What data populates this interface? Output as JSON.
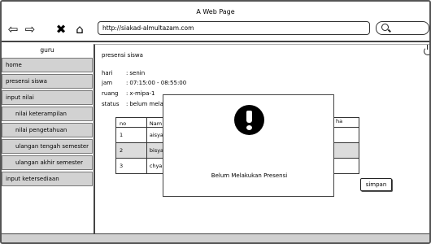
{
  "window": {
    "title": "A Web Page"
  },
  "browser": {
    "url": "http://siakad-almultazam.com",
    "back_icon": "arrow-left-icon",
    "forward_icon": "arrow-right-icon",
    "close_icon": "x-icon",
    "home_icon": "home-icon",
    "search_icon": "search-icon"
  },
  "sidebar": {
    "title": "guru",
    "items": [
      {
        "label": "home"
      },
      {
        "label": "presensi siswa"
      },
      {
        "label": "input nilai"
      },
      {
        "label": "nilai keterampilan"
      },
      {
        "label": "nilai pengetahuan"
      },
      {
        "label": "ulangan tengah semester"
      },
      {
        "label": "ulangan akhir semester"
      },
      {
        "label": "input ketersediaan"
      }
    ]
  },
  "main": {
    "section_title": "presensi siswa",
    "info": [
      {
        "label": "hari",
        "value": "senin"
      },
      {
        "label": "jam",
        "value": "07:15:00 - 08:55:00"
      },
      {
        "label": "ruang",
        "value": "x-mipa-1"
      },
      {
        "label": "status",
        "value": "belum melakukan presensi"
      }
    ],
    "table": {
      "headers": [
        "no",
        "Nama",
        "Presensi"
      ],
      "visible_header_fragments": {
        "col2": "Nam",
        "col3": "ha"
      },
      "rows": [
        {
          "no": "1",
          "name": "aisya"
        },
        {
          "no": "2",
          "name": "bisya"
        },
        {
          "no": "3",
          "name": "chya"
        }
      ]
    },
    "save_label": "simpan",
    "power_icon": "power-icon"
  },
  "modal": {
    "icon": "exclamation-icon",
    "message": "Belum Melakukan Presensi"
  }
}
